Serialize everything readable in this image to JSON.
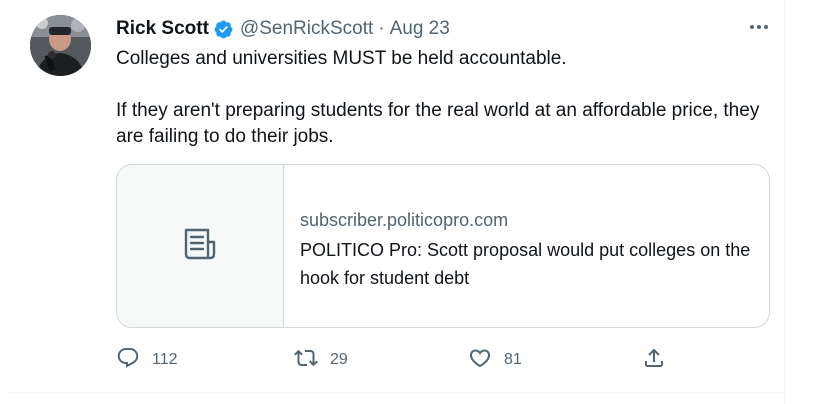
{
  "tweet": {
    "author_name": "Rick Scott",
    "handle": "@SenRickScott",
    "separator": "·",
    "date": "Aug 23",
    "text_line1": "Colleges and universities MUST be held accountable.",
    "text_line2": "If they aren't preparing students for the real world at an affordable price, they are failing to do their jobs."
  },
  "card": {
    "domain": "subscriber.politicopro.com",
    "title": "POLITICO Pro: Scott proposal would put colleges on the hook for student debt"
  },
  "actions": {
    "replies": "112",
    "retweets": "29",
    "likes": "81"
  },
  "icons": {
    "verified": "verified-badge-icon",
    "more": "more-options-icon",
    "reply": "reply-icon",
    "retweet": "retweet-icon",
    "like": "heart-icon",
    "share": "share-icon",
    "card": "article-icon"
  },
  "colors": {
    "accent": "#1d9bf0",
    "muted": "#536471",
    "text": "#0f1419"
  }
}
